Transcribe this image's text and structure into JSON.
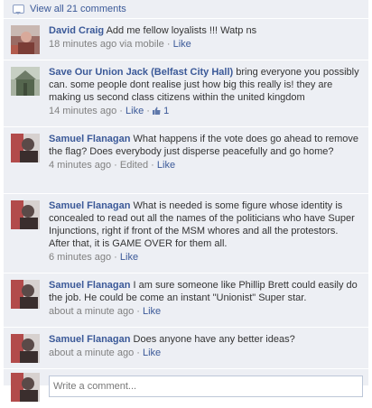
{
  "view_all": "View all 21 comments",
  "comments": [
    {
      "author": "David Craig",
      "text": "Add me fellow loyalists !!! Watp ns",
      "time": "18 minutes ago",
      "via": "via mobile",
      "like_label": "Like"
    },
    {
      "author": "Save Our Union Jack (Belfast City Hall)",
      "text": "bring everyone you possibly can. some people dont realise just how big this really is! they are making us second class citizens within the united kingdom",
      "time": "14 minutes ago",
      "like_label": "Like",
      "like_count": "1"
    },
    {
      "author": "Samuel Flanagan",
      "text": "What happens if the vote does go ahead to remove the flag? Does everybody just disperse peacefully and go home?",
      "time": "4 minutes ago",
      "edited": "Edited",
      "like_label": "Like"
    },
    {
      "author": "Samuel Flanagan",
      "text": "What is needed is some figure whose identity is concealed to read out all the names of the politicians who have Super Injunctions, right if front of the MSM whores and all the protestors. After that, it is GAME OVER for them all.",
      "time": "6 minutes ago",
      "like_label": "Like"
    },
    {
      "author": "Samuel Flanagan",
      "text": "I am sure someone like Phillip Brett could easily do the job. He could be come an instant \"Unionist\" Super star.",
      "time": "about a minute ago",
      "like_label": "Like"
    },
    {
      "author": "Samuel Flanagan",
      "text": "Does anyone have any better ideas?",
      "time": "about a minute ago",
      "like_label": "Like"
    }
  ],
  "composer": {
    "placeholder": "Write a comment..."
  },
  "colors": {
    "link": "#3b5998",
    "panel": "#edeff4",
    "meta": "#808080"
  }
}
